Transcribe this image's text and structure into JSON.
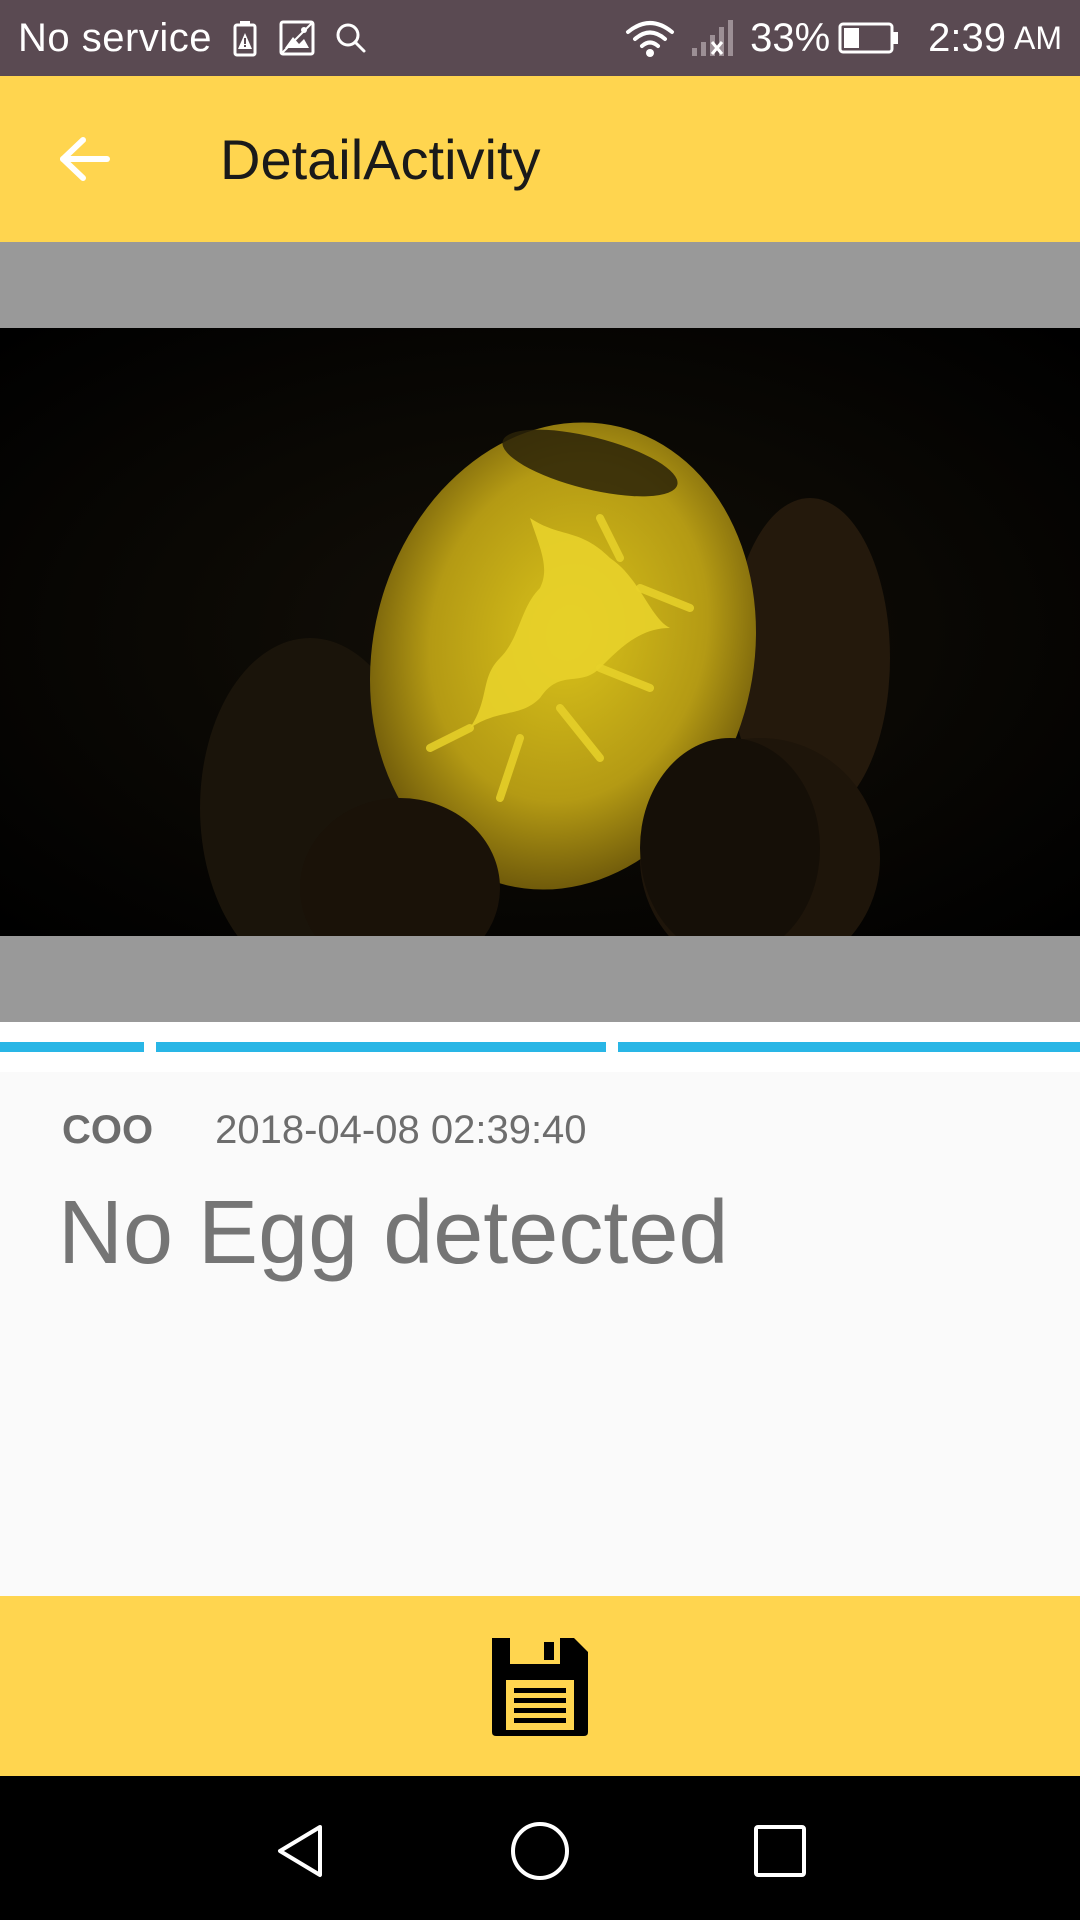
{
  "status_bar": {
    "carrier": "No service",
    "battery_percent": "33%",
    "time": "2:39",
    "ampm": "AM",
    "icons": [
      "battery-saver-alert-icon",
      "image-icon",
      "search-icon",
      "wifi-icon",
      "signal-no-service-icon",
      "battery-icon"
    ]
  },
  "app_bar": {
    "title": "DetailActivity",
    "back_icon": "arrow-left-icon"
  },
  "detail": {
    "code": "COO",
    "timestamp": "2018-04-08 02:39:40",
    "result": "No Egg detected"
  },
  "bottom_bar": {
    "save_icon": "floppy-save-icon"
  },
  "nav_bar": {
    "icons": [
      "back-triangle-icon",
      "home-circle-icon",
      "recents-square-icon"
    ]
  },
  "colors": {
    "status_bar": "#5a4a52",
    "accent": "#ffd54f",
    "progress": "#29b6e6",
    "image_background": "#999999"
  }
}
